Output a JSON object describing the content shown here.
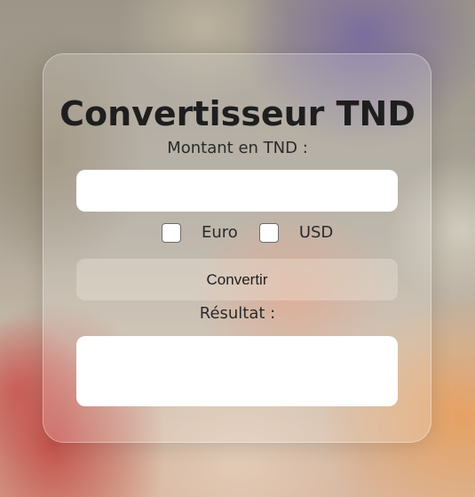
{
  "converter": {
    "title": "Convertisseur TND",
    "amount_label": "Montant en TND :",
    "amount_value": "",
    "currencies": [
      {
        "label": "Euro",
        "checked": false
      },
      {
        "label": "USD",
        "checked": false
      }
    ],
    "convert_label": "Convertir",
    "result_label": "Résultat :",
    "result_value": ""
  }
}
